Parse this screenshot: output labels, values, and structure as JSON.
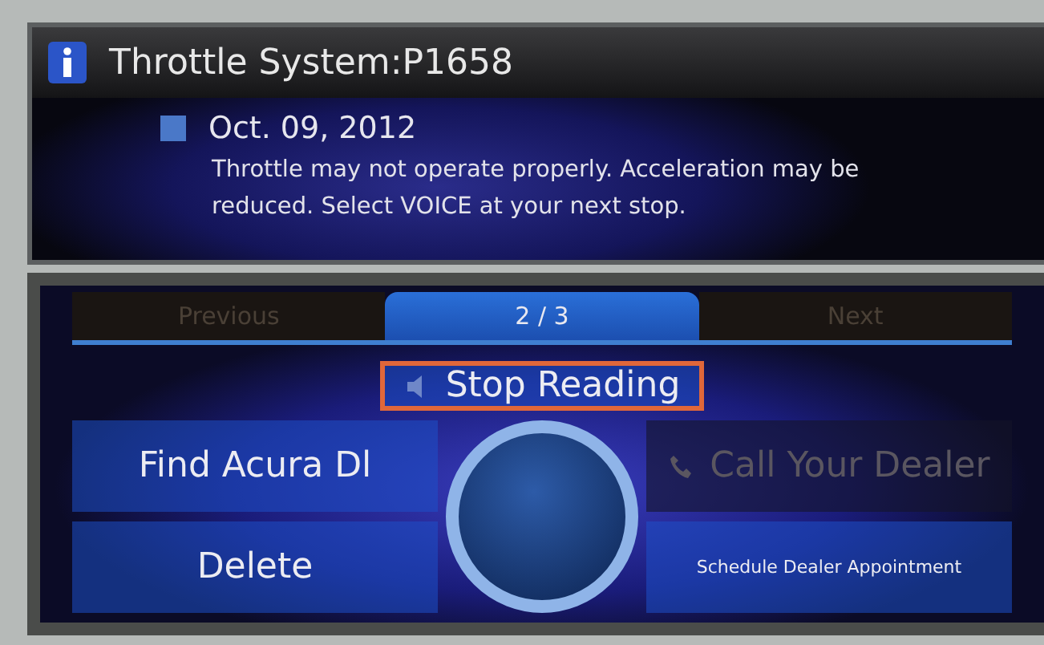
{
  "header": {
    "title": "Throttle System:P1658"
  },
  "message": {
    "date": "Oct. 09, 2012",
    "text": "Throttle may not operate properly. Acceleration may be reduced. Select VOICE at your next stop."
  },
  "tabs": [
    {
      "label": "Previous",
      "selected": false
    },
    {
      "label": "2 / 3",
      "selected": true
    },
    {
      "label": "Next",
      "selected": false
    }
  ],
  "menu": [
    {
      "label": "Stop Reading",
      "kind": "large",
      "selected": true,
      "disabled": false
    },
    {
      "label": "Find Acura Dl",
      "kind": "large",
      "selected": false,
      "disabled": false
    },
    {
      "label": "Call Your Dealer",
      "kind": "large",
      "selected": false,
      "disabled": true
    },
    {
      "label": "Delete",
      "kind": "large",
      "selected": false,
      "disabled": false
    },
    {
      "label": "Schedule Dealer Appointment",
      "kind": "small",
      "selected": false,
      "disabled": false
    }
  ]
}
